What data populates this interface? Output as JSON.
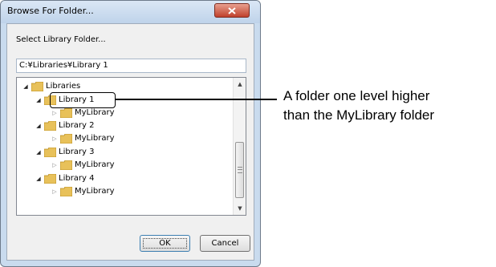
{
  "dialog": {
    "title": "Browse For Folder...",
    "close_symbol": "x",
    "prompt": "Select Library Folder...",
    "path_value": "C:¥Libraries¥Library 1",
    "ok_label": "OK",
    "cancel_label": "Cancel"
  },
  "tree": {
    "root": "Libraries",
    "nodes": [
      {
        "label": "Library 1",
        "expanded": true,
        "selected": true
      },
      {
        "label": "MyLibrary",
        "expanded": false
      },
      {
        "label": "Library 2",
        "expanded": true
      },
      {
        "label": "MyLibrary",
        "expanded": false
      },
      {
        "label": "Library 3",
        "expanded": true
      },
      {
        "label": "MyLibrary",
        "expanded": false
      },
      {
        "label": "Library 4",
        "expanded": true
      },
      {
        "label": "MyLibrary",
        "expanded": false
      }
    ],
    "expander_open": "◢",
    "expander_closed": "▷",
    "scroll_up": "▲",
    "scroll_down": "▼"
  },
  "annotation": {
    "line1": "A folder one level higher",
    "line2": "than the MyLibrary folder"
  },
  "colors": {
    "frame": "#c9dbee",
    "close_button": "#c0412c",
    "folder": "#e8c15a"
  }
}
